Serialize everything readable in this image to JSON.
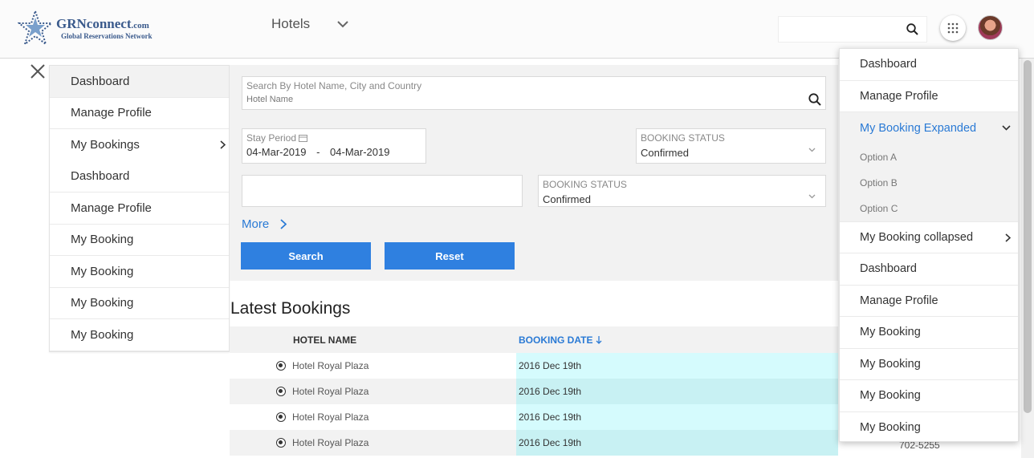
{
  "header": {
    "logo_main": "GRNconnect",
    "logo_dotcom": ".com",
    "logo_sub": "Global Reservations Network",
    "product_select": "Hotels",
    "search_placeholder": ""
  },
  "left_menu": {
    "items": [
      {
        "label": "Dashboard"
      },
      {
        "label": "Manage Profile"
      },
      {
        "label": "My Bookings"
      },
      {
        "label": "Dashboard"
      },
      {
        "label": "Manage Profile"
      },
      {
        "label": "My Booking"
      },
      {
        "label": "My Booking"
      },
      {
        "label": "My Booking"
      },
      {
        "label": "My Booking"
      }
    ]
  },
  "filters": {
    "hotel_search_label": "Search By Hotel Name, City and Country",
    "hotel_search_value": "Hotel Name",
    "stay_period_label": "Stay Period",
    "stay_from": "04-Mar-2019",
    "stay_sep": "-",
    "stay_to": "04-Mar-2019",
    "booking_status_label_1": "BOOKING STATUS",
    "booking_status_value_1": "Confirmed",
    "booking_status_label_2": "BOOKING STATUS",
    "booking_status_value_2": "Confirmed",
    "more_label": "More",
    "search_btn": "Search",
    "reset_btn": "Reset"
  },
  "latest": {
    "title": "Latest Bookings",
    "col_hotel": "HOTEL NAME",
    "col_date": "BOOKING DATE",
    "rows": [
      {
        "hotel": "Hotel Royal Plaza",
        "date": "2016 Dec 19th"
      },
      {
        "hotel": "Hotel Royal Plaza",
        "date": "2016 Dec 19th"
      },
      {
        "hotel": "Hotel Royal Plaza",
        "date": "2016 Dec 19th"
      },
      {
        "hotel": "Hotel Royal Plaza",
        "date": "2016 Dec 19th"
      }
    ],
    "peek_text": "702-5255"
  },
  "dropdown": {
    "items_top": [
      "Dashboard",
      "Manage Profile"
    ],
    "expanded_label": "My Booking Expanded",
    "options": [
      "Option A",
      "Option B",
      "Option C"
    ],
    "collapsed_label": "My Booking collapsed",
    "items_bottom": [
      "Dashboard",
      "Manage Profile",
      "My Booking",
      "My Booking",
      "My Booking",
      "My Booking"
    ]
  },
  "colors": {
    "accent": "#2f80e0",
    "link": "#2a7ad5",
    "highlight_col": "#d5fbfd"
  }
}
